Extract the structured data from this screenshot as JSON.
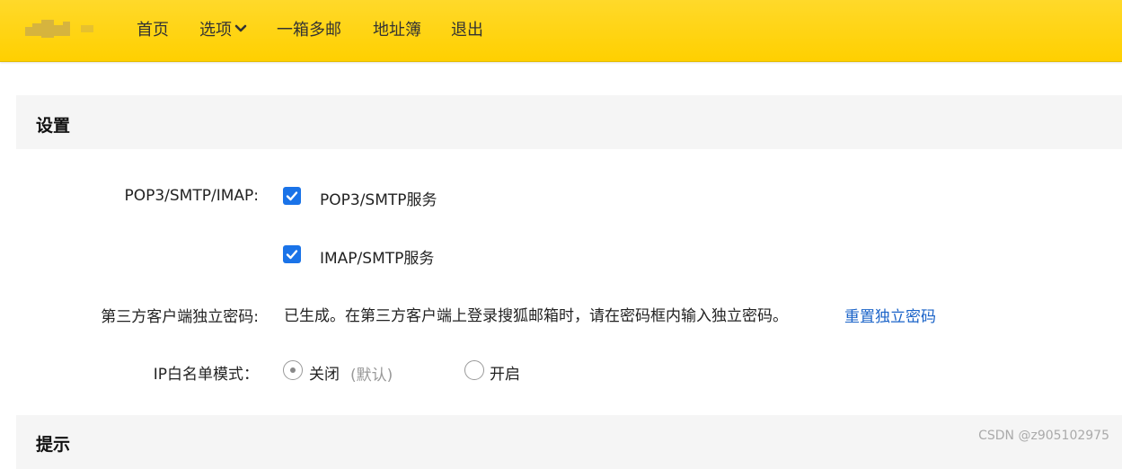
{
  "nav": {
    "items": [
      {
        "label": "首页"
      },
      {
        "label": "选项"
      },
      {
        "label": "一箱多邮"
      },
      {
        "label": "地址簿"
      },
      {
        "label": "退出"
      }
    ],
    "options_icon": "chevron-down-icon"
  },
  "settings": {
    "title": "设置",
    "pop3": {
      "label": "POP3/SMTP/IMAP:",
      "pop3_smtp": {
        "label": "POP3/SMTP服务",
        "checked": true
      },
      "imap_smtp": {
        "label": "IMAP/SMTP服务",
        "checked": true
      }
    },
    "client_password": {
      "label": "第三方客户端独立密码:",
      "status": "已生成。在第三方客户端上登录搜狐邮箱时，请在密码框内输入独立密码。",
      "reset_link": "重置独立密码"
    },
    "ip_whitelist": {
      "label": "IP白名单模式：",
      "off_label": "关闭",
      "off_note": "(默认)",
      "on_label": "开启",
      "selected": "off"
    }
  },
  "tips": {
    "title": "提示"
  },
  "watermark": "CSDN @z905102975",
  "colors": {
    "topbar": "#ffd400",
    "checkbox": "#1a73e8",
    "link": "#1a63c8"
  }
}
